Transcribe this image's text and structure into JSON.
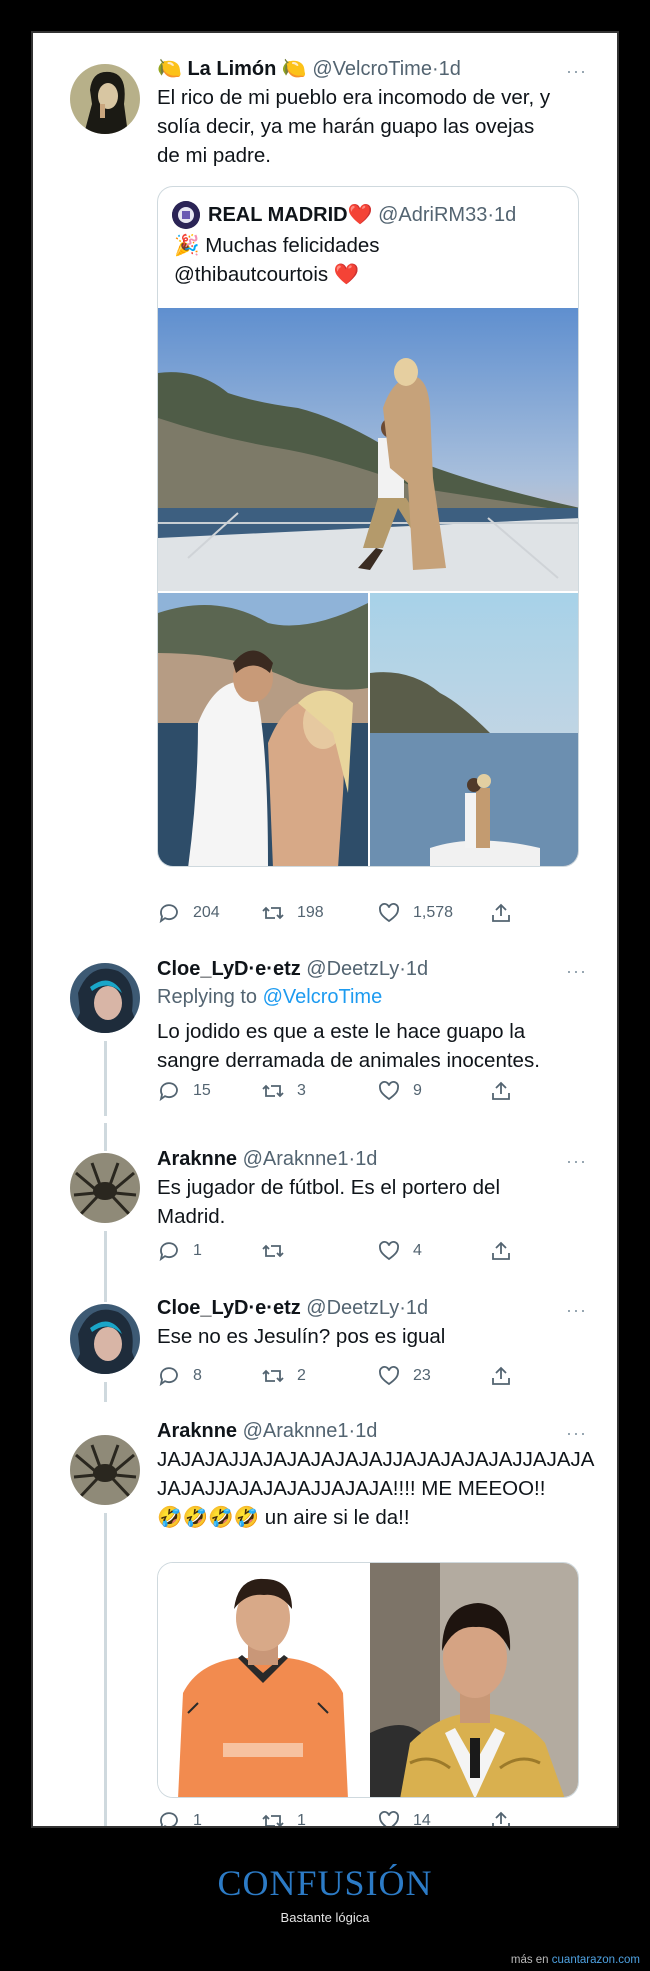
{
  "tweets": [
    {
      "name": "🍋 La Limón 🍋",
      "handle": "@VelcroTime",
      "time": "1d",
      "text_lines": [
        "El rico de mi pueblo era incomodo de ver, y",
        "solía decir, ya me harán guapo las ovejas",
        "de mi padre."
      ],
      "quote": {
        "name": "REAL MADRID❤️",
        "handle": "@AdriRM33",
        "time": "1d",
        "text_lines": [
          "🎉 Muchas felicidades",
          "@thibautcourtois ❤️"
        ]
      },
      "replies": "204",
      "retweets": "198",
      "likes": "1,578"
    },
    {
      "name": "Cloe_LyD·e·etz",
      "handle": "@DeetzLy",
      "time": "1d",
      "replying_label": "Replying to",
      "replying_handle": "@VelcroTime",
      "text_lines": [
        "Lo jodido es que a este le hace guapo la",
        "sangre derramada de animales inocentes."
      ],
      "replies": "15",
      "retweets": "3",
      "likes": "9"
    },
    {
      "name": "Araknne",
      "handle": "@Araknne1",
      "time": "1d",
      "text_lines": [
        "Es jugador de fútbol. Es el portero del",
        "Madrid."
      ],
      "replies": "1",
      "retweets": "",
      "likes": "4"
    },
    {
      "name": "Cloe_LyD·e·etz",
      "handle": "@DeetzLy",
      "time": "1d",
      "text_lines": [
        "Ese no es Jesulín? pos es igual"
      ],
      "replies": "8",
      "retweets": "2",
      "likes": "23"
    },
    {
      "name": "Araknne",
      "handle": "@Araknne1",
      "time": "1d",
      "text_lines": [
        "JAJAJAJJAJAJAJAJAJAJJAJAJAJAJAJJAJAJA",
        "JAJAJJAJAJAJAJJAJAJA!!!! ME MEEOO!!",
        "🤣🤣🤣🤣 un aire si le da!!"
      ],
      "replies": "1",
      "retweets": "1",
      "likes": "14"
    }
  ],
  "more_glyph": "···",
  "dot": "·",
  "footer": {
    "title": "CONFUSIÓN",
    "subtitle": "Bastante lógica",
    "credit_prefix": "más en",
    "credit_link": "cuantarazon.com"
  },
  "colors": {
    "link": "#1d9bf0",
    "brand": "#2c7bc6",
    "thread_line": "#cfd9de"
  }
}
